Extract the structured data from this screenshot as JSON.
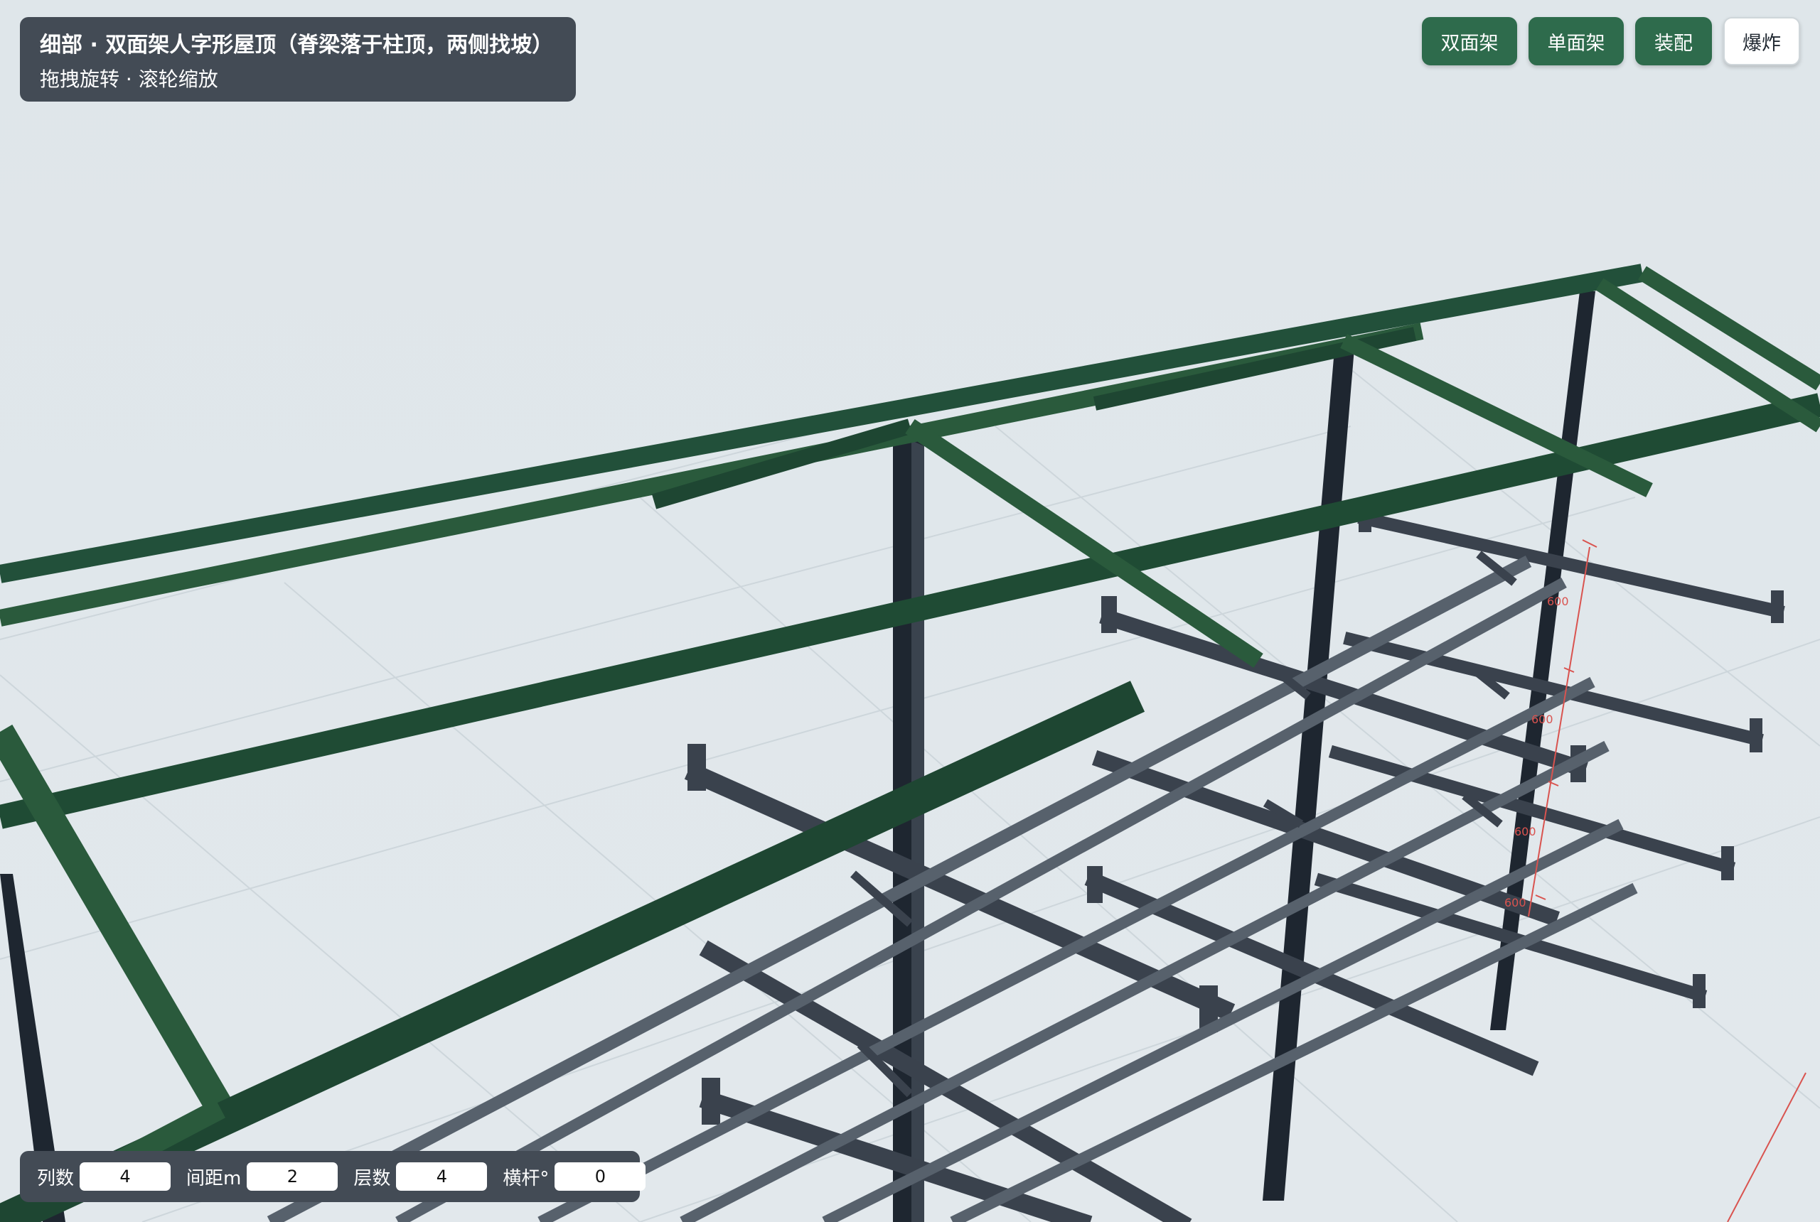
{
  "header": {
    "title": "细部 · 双面架人字形屋顶（脊梁落于柱顶，两侧找坡）",
    "subtitle": "拖拽旋转 · 滚轮缩放"
  },
  "toolbar": {
    "double_rack_label": "双面架",
    "single_rack_label": "单面架",
    "assemble_label": "装配",
    "explode_label": "爆炸"
  },
  "params": {
    "columns_label": "列数",
    "columns_value": "4",
    "spacing_label": "间距m",
    "spacing_value": "2",
    "levels_label": "层数",
    "levels_value": "4",
    "crossbar_label": "横杆°",
    "crossbar_value": "0"
  },
  "dimensions": {
    "d1": "600",
    "d2": "600",
    "d3": "600",
    "d4": "600"
  },
  "colors": {
    "background": "#dfe6ea",
    "roof_green": "#2a5a3c",
    "column_dark": "#1e2630",
    "arm_steel": "#3a424d",
    "panel": "#434b55",
    "button_green": "#2e6b4c",
    "dimension_red": "#d9534f"
  }
}
